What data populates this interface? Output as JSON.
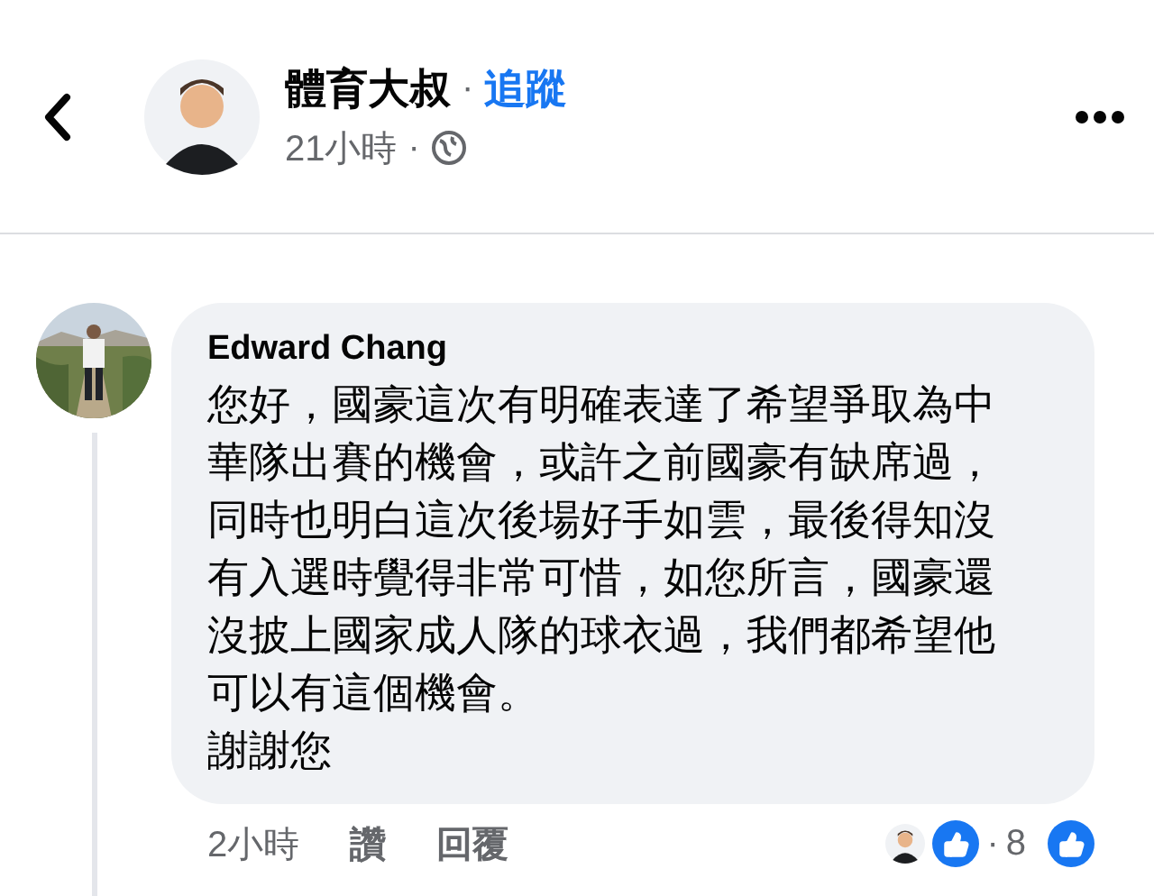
{
  "header": {
    "author": "體育大叔",
    "follow_separator": "·",
    "follow": "追蹤",
    "time": "21小時",
    "time_separator": "·"
  },
  "comment": {
    "author": "Edward Chang",
    "paragraphs": [
      "您好，國豪這次有明確表達了希望爭取為中華隊出賽的機會，或許之前國豪有缺席過，同時也明白這次後場好手如雲，最後得知沒有入選時覺得非常可惜，如您所言，國豪還沒披上國家成人隊的球衣過，我們都希望他可以有這個機會。",
      "謝謝您"
    ],
    "time": "2小時",
    "actions": [
      "讚",
      "回覆"
    ],
    "count_separator": "·",
    "reaction_count": "8"
  }
}
